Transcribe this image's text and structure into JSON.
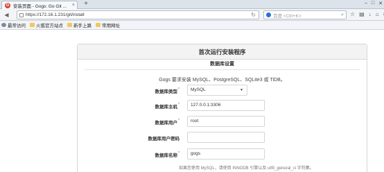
{
  "browser": {
    "tab_title": "安装页面 - Gogs: Go Git ...",
    "tab_close": "×",
    "new_tab": "+",
    "url": "https://172.16.1.231/git/install",
    "search_placeholder": "百度 <Ctrl+K>",
    "bookmarks": [
      "最常访问",
      "火狐官方站点",
      "新手上路",
      "常用网址"
    ]
  },
  "install": {
    "page_title": "首次运行安装程序",
    "section_title": "数据库设置",
    "requirement_note": "Gogs 要求安装 MySQL、PostgreSQL、SQLite3 或 TiDB。",
    "fields": [
      {
        "label": "数据库类型",
        "value": "MySQL",
        "type": "select"
      },
      {
        "label": "数据库主机",
        "value": "127.0.0.1:3306",
        "type": "text"
      },
      {
        "label": "数据库用户",
        "value": "root",
        "type": "text"
      },
      {
        "label": "数据库用户密码",
        "value": "",
        "type": "password"
      },
      {
        "label": "数据库名称",
        "value": "gogs",
        "type": "text"
      }
    ],
    "required_mark": "*",
    "help_text": "如果您使用 MySQL，请使用 INNODB 引擎以及 utf8_general_ci 字符集。"
  },
  "colors": {
    "required": "#db2828",
    "panel_header_bg": "#f3f3f3"
  }
}
